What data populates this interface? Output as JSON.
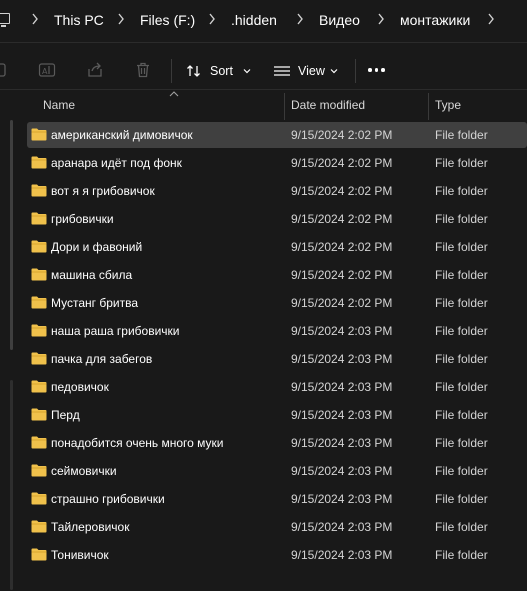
{
  "breadcrumb": {
    "items": [
      "This PC",
      "Files (F:)",
      ".hidden",
      "Видео",
      "монтажики"
    ]
  },
  "toolbar": {
    "sort_label": "Sort",
    "view_label": "View"
  },
  "columns": {
    "name": "Name",
    "date_modified": "Date modified",
    "type": "Type"
  },
  "files": [
    {
      "name": "американский димовичок",
      "date": "9/15/2024 2:02 PM",
      "type": "File folder",
      "selected": true
    },
    {
      "name": "аранара идёт под фонк",
      "date": "9/15/2024 2:02 PM",
      "type": "File folder"
    },
    {
      "name": "вот я я грибовичок",
      "date": "9/15/2024 2:02 PM",
      "type": "File folder"
    },
    {
      "name": "грибовички",
      "date": "9/15/2024 2:02 PM",
      "type": "File folder"
    },
    {
      "name": "Дори и фавоний",
      "date": "9/15/2024 2:02 PM",
      "type": "File folder"
    },
    {
      "name": "машина сбила",
      "date": "9/15/2024 2:02 PM",
      "type": "File folder"
    },
    {
      "name": "Мустанг бритва",
      "date": "9/15/2024 2:02 PM",
      "type": "File folder"
    },
    {
      "name": "наша раша грибовички",
      "date": "9/15/2024 2:03 PM",
      "type": "File folder"
    },
    {
      "name": "пачка для забегов",
      "date": "9/15/2024 2:03 PM",
      "type": "File folder"
    },
    {
      "name": "педовичок",
      "date": "9/15/2024 2:03 PM",
      "type": "File folder"
    },
    {
      "name": "Перд",
      "date": "9/15/2024 2:03 PM",
      "type": "File folder"
    },
    {
      "name": "понадобится очень много муки",
      "date": "9/15/2024 2:03 PM",
      "type": "File folder"
    },
    {
      "name": "сеймовички",
      "date": "9/15/2024 2:03 PM",
      "type": "File folder"
    },
    {
      "name": "страшно грибовички",
      "date": "9/15/2024 2:03 PM",
      "type": "File folder"
    },
    {
      "name": "Тайлеровичок",
      "date": "9/15/2024 2:03 PM",
      "type": "File folder"
    },
    {
      "name": "Тонивичок",
      "date": "9/15/2024 2:03 PM",
      "type": "File folder"
    }
  ],
  "colors": {
    "background": "#191919",
    "selected_row": "#404040",
    "folder": "#f0c14b"
  },
  "icons": {
    "computer": "monitor-icon",
    "separator": "chevron-right-icon",
    "cut": "scissors-icon",
    "rename": "rename-icon",
    "share": "share-icon",
    "delete": "trash-icon",
    "sort": "sort-icon",
    "view": "view-list-icon",
    "more": "more-horizontal-icon",
    "folder": "folder-icon"
  }
}
